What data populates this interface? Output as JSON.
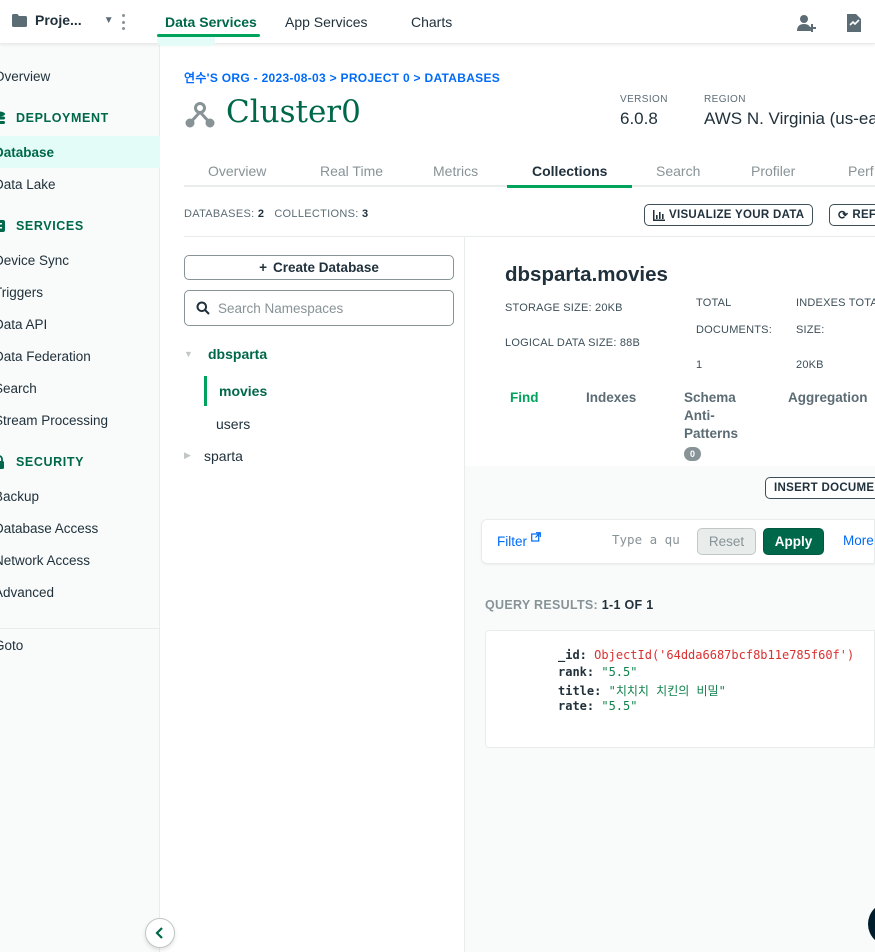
{
  "topbar": {
    "project_name": "Proje...",
    "tabs": [
      {
        "label": "Data Services"
      },
      {
        "label": "App Services"
      },
      {
        "label": "Charts"
      }
    ]
  },
  "sidebar": {
    "overview": "Overview",
    "deployment_header": "DEPLOYMENT",
    "database": "Database",
    "data_lake": "Data Lake",
    "services_header": "SERVICES",
    "device_sync": "Device Sync",
    "triggers": "Triggers",
    "data_api": "Data API",
    "data_federation": "Data Federation",
    "search": "Search",
    "stream_processing": "Stream Processing",
    "security_header": "SECURITY",
    "backup": "Backup",
    "database_access": "Database Access",
    "network_access": "Network Access",
    "advanced": "Advanced",
    "goto": "Goto"
  },
  "header": {
    "breadcrumb": "연수'S ORG - 2023-08-03 > PROJECT 0 > DATABASES",
    "cluster_name": "Cluster0",
    "version_label": "VERSION",
    "version_value": "6.0.8",
    "region_label": "REGION",
    "region_value": "AWS N. Virginia (us-ea"
  },
  "cluster_tabs": [
    {
      "label": "Overview"
    },
    {
      "label": "Real Time"
    },
    {
      "label": "Metrics"
    },
    {
      "label": "Collections"
    },
    {
      "label": "Search"
    },
    {
      "label": "Profiler"
    },
    {
      "label": "Perf"
    }
  ],
  "counts": {
    "databases_label": "DATABASES:",
    "databases_value": "2",
    "collections_label": "COLLECTIONS:",
    "collections_value": "3"
  },
  "toolbar": {
    "visualize_label": "VISUALIZE YOUR DATA",
    "refresh_label": "REFR"
  },
  "namespaces": {
    "create_db_label": "Create Database",
    "search_placeholder": "Search Namespaces",
    "databases": [
      {
        "name": "dbsparta",
        "collections": [
          "movies",
          "users"
        ]
      },
      {
        "name": "sparta"
      }
    ]
  },
  "collection": {
    "title": "dbsparta.movies",
    "storage_size": "STORAGE SIZE: 20KB",
    "logical_size": "LOGICAL DATA SIZE: 88B",
    "total_docs_label_1": "TOTAL",
    "total_docs_label_2": "DOCUMENTS:",
    "total_docs_value": "1",
    "indexes_label_1": "INDEXES TOTAL",
    "indexes_label_2": "SIZE:",
    "indexes_value": "20KB",
    "subtabs": [
      {
        "label": "Find"
      },
      {
        "label": "Indexes"
      },
      {
        "label": "Schema"
      },
      {
        "label": "Anti-"
      },
      {
        "label": "Patterns"
      },
      {
        "label": "Aggregation"
      }
    ],
    "schema_badge": "0",
    "insert_label": "INSERT DOCUMEN"
  },
  "filter": {
    "link_label": "Filter",
    "input_placeholder": "Type a qu",
    "reset_label": "Reset",
    "apply_label": "Apply",
    "more_label": "More"
  },
  "results": {
    "label": "QUERY RESULTS:",
    "value": "1-1 OF 1",
    "document": {
      "id_key": "_id:",
      "id_value": "ObjectId('64dda6687bcf8b11e785f60f')",
      "rank_key": "rank:",
      "rank_value": "\"5.5\"",
      "title_key": "title:",
      "title_value": "\"치치치 치킨의 비밀\"",
      "rate_key": "rate:",
      "rate_value": "\"5.5\""
    }
  },
  "colors": {
    "brand_green": "#00684a",
    "accent_green": "#00a35c",
    "link_blue": "#016bf8",
    "active_bg": "#e3fcf7"
  }
}
